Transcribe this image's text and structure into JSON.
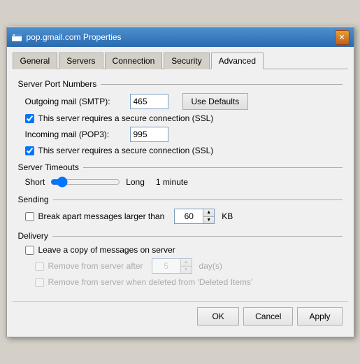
{
  "window": {
    "title": "pop.gmail.com Properties",
    "close_label": "✕"
  },
  "tabs": {
    "items": [
      {
        "label": "General"
      },
      {
        "label": "Servers"
      },
      {
        "label": "Connection"
      },
      {
        "label": "Security"
      },
      {
        "label": "Advanced"
      }
    ],
    "active_index": 4
  },
  "sections": {
    "server_ports": {
      "label": "Server Port Numbers",
      "outgoing_label": "Outgoing mail (SMTP):",
      "outgoing_value": "465",
      "use_defaults_label": "Use Defaults",
      "ssl_outgoing_label": "This server requires a secure connection (SSL)",
      "ssl_outgoing_checked": true,
      "incoming_label": "Incoming mail (POP3):",
      "incoming_value": "995",
      "ssl_incoming_label": "This server requires a secure connection (SSL)",
      "ssl_incoming_checked": true
    },
    "server_timeouts": {
      "label": "Server Timeouts",
      "short_label": "Short",
      "long_label": "Long",
      "timeout_value": "1 minute"
    },
    "sending": {
      "label": "Sending",
      "break_apart_label": "Break apart messages larger than",
      "break_apart_checked": false,
      "size_value": "60",
      "kb_label": "KB"
    },
    "delivery": {
      "label": "Delivery",
      "leave_copy_label": "Leave a copy of messages on server",
      "leave_copy_checked": false,
      "remove_after_label": "Remove from server after",
      "remove_after_value": "5",
      "days_label": "day(s)",
      "remove_deleted_label": "Remove from server when deleted from 'Deleted Items'"
    }
  },
  "footer": {
    "ok_label": "OK",
    "cancel_label": "Cancel",
    "apply_label": "Apply"
  }
}
